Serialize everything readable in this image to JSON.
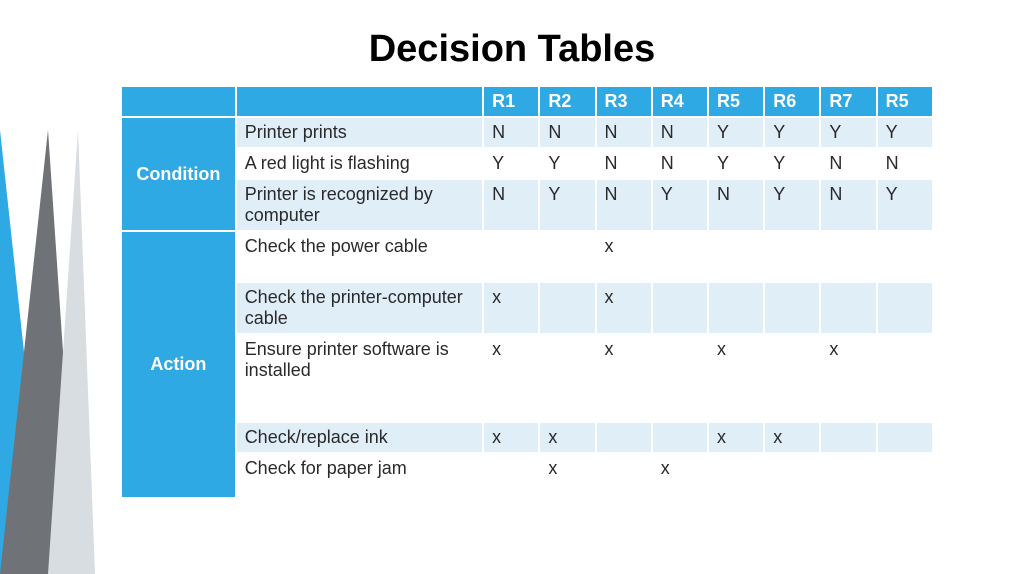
{
  "title": "Decision Tables",
  "headers": [
    "R1",
    "R2",
    "R3",
    "R4",
    "R5",
    "R6",
    "R7",
    "R5"
  ],
  "sections": {
    "condition": "Condition",
    "action": "Action"
  },
  "conditions": [
    {
      "label": "Printer prints",
      "cells": [
        "N",
        "N",
        "N",
        "N",
        "Y",
        "Y",
        "Y",
        "Y"
      ]
    },
    {
      "label": "A red light is flashing",
      "cells": [
        "Y",
        "Y",
        "N",
        "N",
        "Y",
        "Y",
        "N",
        "N"
      ]
    },
    {
      "label": "Printer is recognized by computer",
      "cells": [
        "N",
        "Y",
        "N",
        "Y",
        "N",
        "Y",
        "N",
        "Y"
      ]
    }
  ],
  "actions": [
    {
      "label": "Check the power cable",
      "cells": [
        "",
        "",
        "x",
        "",
        "",
        "",
        "",
        ""
      ]
    },
    {
      "label": "Check the printer-computer cable",
      "cells": [
        "x",
        "",
        "x",
        "",
        "",
        "",
        "",
        ""
      ]
    },
    {
      "label": "Ensure printer software is installed",
      "cells": [
        "x",
        "",
        "x",
        "",
        "x",
        "",
        "x",
        ""
      ]
    },
    {
      "label": "Check/replace ink",
      "cells": [
        "x",
        "x",
        "",
        "",
        "x",
        "x",
        "",
        ""
      ]
    },
    {
      "label": "Check for paper jam",
      "cells": [
        "",
        "x",
        "",
        "x",
        "",
        "",
        "",
        ""
      ]
    }
  ]
}
